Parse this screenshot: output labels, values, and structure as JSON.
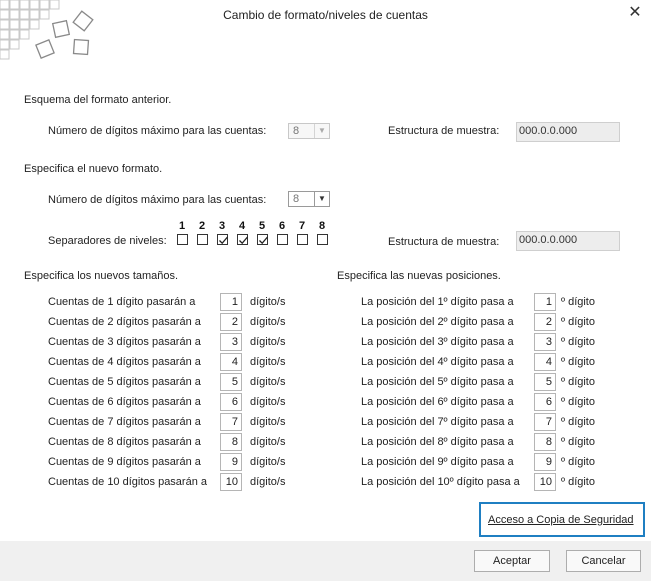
{
  "window": {
    "title": "Cambio de formato/niveles de cuentas"
  },
  "old_format": {
    "heading": "Esquema del formato anterior.",
    "max_digits_label": "Número de dígitos máximo para las cuentas:",
    "max_digits_value": "8",
    "sample_label": "Estructura de muestra:",
    "sample_value": "000.0.0.000"
  },
  "new_format": {
    "heading": "Especifica el nuevo formato.",
    "max_digits_label": "Número de dígitos máximo para las cuentas:",
    "max_digits_value": "8",
    "separators_label": "Separadores de niveles:",
    "separator_numbers": [
      "1",
      "2",
      "3",
      "4",
      "5",
      "6",
      "7",
      "8"
    ],
    "separator_checked": [
      false,
      false,
      true,
      true,
      true,
      false,
      false,
      false
    ],
    "sample_label": "Estructura de muestra:",
    "sample_value": "000.0.0.000"
  },
  "sizes": {
    "heading": "Especifica los nuevos tamaños.",
    "rows": [
      {
        "label": "Cuentas de 1 dígito pasarán a",
        "value": "1",
        "unit": "dígito/s"
      },
      {
        "label": "Cuentas de 2 dígitos pasarán a",
        "value": "2",
        "unit": "dígito/s"
      },
      {
        "label": "Cuentas de 3 dígitos pasarán a",
        "value": "3",
        "unit": "dígito/s"
      },
      {
        "label": "Cuentas de 4 dígitos pasarán a",
        "value": "4",
        "unit": "dígito/s"
      },
      {
        "label": "Cuentas de 5 dígitos pasarán a",
        "value": "5",
        "unit": "dígito/s"
      },
      {
        "label": "Cuentas de 6 dígitos pasarán a",
        "value": "6",
        "unit": "dígito/s"
      },
      {
        "label": "Cuentas de 7 dígitos pasarán a",
        "value": "7",
        "unit": "dígito/s"
      },
      {
        "label": "Cuentas de 8 dígitos pasarán a",
        "value": "8",
        "unit": "dígito/s"
      },
      {
        "label": "Cuentas de 9 dígitos pasarán a",
        "value": "9",
        "unit": "dígito/s"
      },
      {
        "label": "Cuentas de 10 dígitos pasarán a",
        "value": "10",
        "unit": "dígito/s"
      }
    ]
  },
  "positions": {
    "heading": "Especifica las nuevas posiciones.",
    "rows": [
      {
        "label": "La posición del 1º dígito pasa a",
        "value": "1",
        "unit": "º dígito"
      },
      {
        "label": "La posición del 2º dígito pasa a",
        "value": "2",
        "unit": "º dígito"
      },
      {
        "label": "La posición del 3º dígito pasa a",
        "value": "3",
        "unit": "º dígito"
      },
      {
        "label": "La posición del 4º dígito pasa a",
        "value": "4",
        "unit": "º dígito"
      },
      {
        "label": "La posición del 5º dígito pasa a",
        "value": "5",
        "unit": "º dígito"
      },
      {
        "label": "La posición del 6º dígito pasa a",
        "value": "6",
        "unit": "º dígito"
      },
      {
        "label": "La posición del 7º dígito pasa a",
        "value": "7",
        "unit": "º dígito"
      },
      {
        "label": "La posición del 8º dígito pasa a",
        "value": "8",
        "unit": "º dígito"
      },
      {
        "label": "La posición del 9º dígito pasa a",
        "value": "9",
        "unit": "º dígito"
      },
      {
        "label": "La posición del 10º dígito pasa a",
        "value": "10",
        "unit": "º dígito"
      }
    ]
  },
  "backup_link": "Acceso a Copia de Seguridad",
  "buttons": {
    "accept": "Aceptar",
    "cancel": "Cancelar"
  },
  "icons": {
    "close": "close-icon",
    "logo": "logo-squares-icon",
    "dropdown": "chevron-down-icon"
  },
  "colors": {
    "accent_border": "#1f7fc2",
    "footer_bg": "#f0f0f0"
  }
}
